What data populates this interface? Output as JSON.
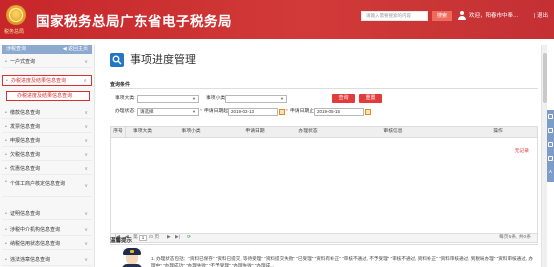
{
  "header": {
    "emblem_text": "税务总局",
    "title": "国家税务总局广东省电子税务局",
    "search_placeholder": "请输入需要搜索的内容",
    "search_button": "搜索",
    "user_greeting": "欢迎，阳春市中奉…",
    "logout": "| 退出"
  },
  "sidebar": {
    "head_label": "涉税查询",
    "back_label": "◀ 返回主页",
    "items": [
      {
        "label": "一户式查询"
      },
      {
        "label": "办税进度及结果信息查询"
      },
      {
        "label": "办税进度及结果信息查询"
      },
      {
        "label": "缴款信息查询"
      },
      {
        "label": "发票信息查询"
      },
      {
        "label": "申报信息查询"
      },
      {
        "label": "欠税信息查询"
      },
      {
        "label": "优惠信息查询"
      },
      {
        "label": "个体工商户核定信息查询"
      },
      {
        "label": "证明信息查询"
      },
      {
        "label": "涉税中介机构信息查询"
      },
      {
        "label": "纳税信用状态信息查询"
      },
      {
        "label": "违法违章信息查询"
      }
    ]
  },
  "main": {
    "page_title": "事项进度管理",
    "query_section": "查询条件",
    "filters": {
      "item_category_label": "事项大类:",
      "item_category_value": "",
      "item_subcategory_label": "事项小类:",
      "item_subcategory_value": "",
      "status_label": "办理状态:",
      "status_value": "请选择",
      "date_start_label": "申请日期起:",
      "date_start_value": "2019-02-13",
      "date_end_label": "申请日期止:",
      "date_end_value": "2019-05-15",
      "query_button": "查询",
      "reset_button": "重置"
    },
    "table": {
      "columns": [
        "序号",
        "事项大类",
        "事项小类",
        "申请日期",
        "办理状态",
        "审核信息",
        "操作"
      ],
      "empty_text": "无记录"
    },
    "pager": {
      "first": "|◀",
      "prev": "◀",
      "page_label_pre": "第",
      "current_page": "1",
      "total_pages_text": "/0 页",
      "next": "▶",
      "last": "▶|",
      "refresh_icon": "⟳",
      "summary": "每页5条, 共0条"
    },
    "tips": {
      "title": "温馨提示",
      "text": "1. 办理状态包括：\"资料已保存\" \"资料已提交, 等待受理\" \"资料提交失败\" \"已受理\" \"资料有补正\" \"审核不通过, 不予受理\" \"审核不通过, 资料补正\" \"资料审核通过, 到税局办理\" \"资料审核通过, 办理中\" \"办理成功\" \"办理失败\" \"不予受理\" \"办理失败\" \"办理成..."
    }
  },
  "colors": {
    "header_red": "#c7262b",
    "accent_red": "#e23b3b",
    "sidebar_head": "#8ca9cf",
    "title_icon_blue": "#2277c5"
  }
}
